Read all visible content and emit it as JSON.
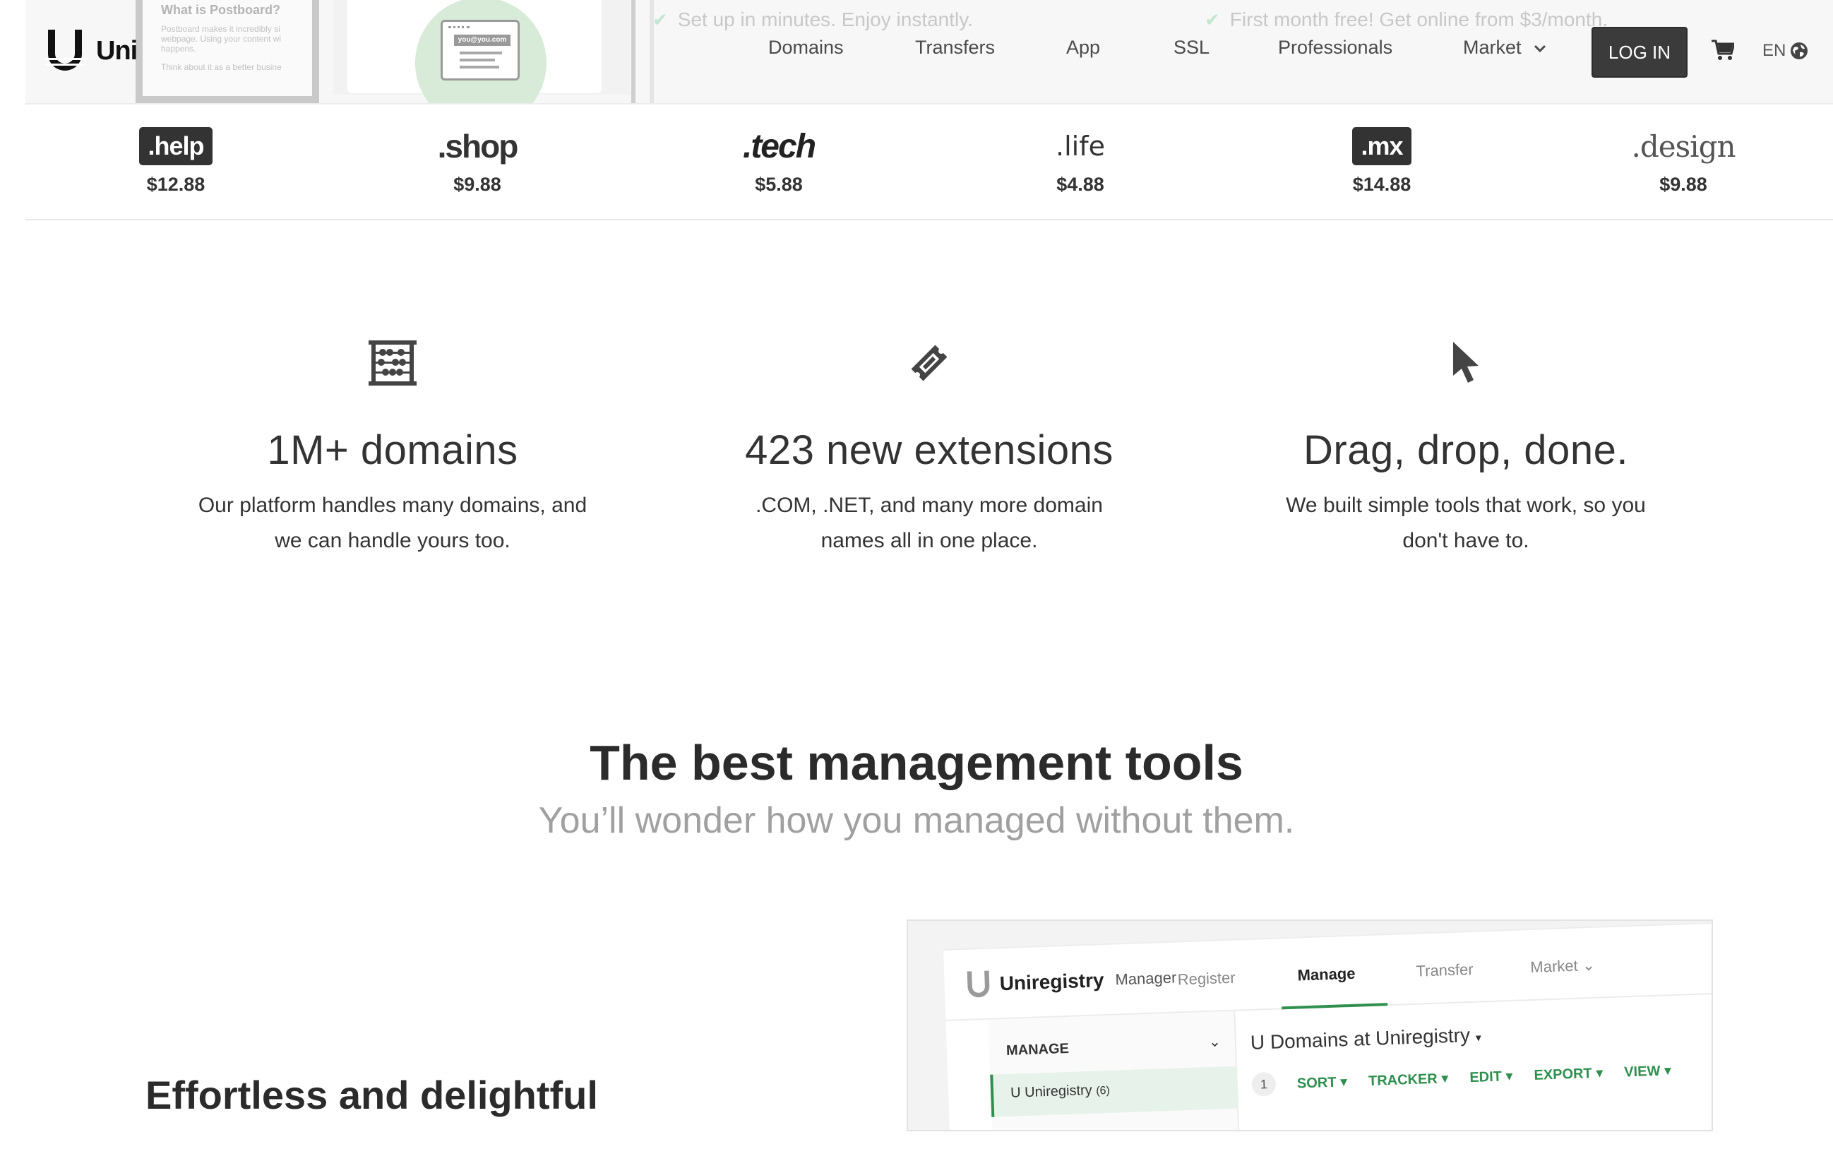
{
  "hero": {
    "phone_title": "What is Postboard?",
    "phone_lines": [
      "Postboard makes it incredibly si",
      "webpage. Using your content wi",
      "happens.",
      "Think about it as a better busine"
    ],
    "mock_email": "you@you.com",
    "perks": [
      "Set up in minutes. Enjoy instantly.",
      "First month free! Get online from $3/month."
    ]
  },
  "header": {
    "logo_text": "Uni",
    "nav": [
      "Domains",
      "Transfers",
      "App",
      "SSL",
      "Professionals",
      "Market"
    ],
    "market_chevron": "⌄",
    "login": "LOG IN",
    "language": "EN"
  },
  "extensions": [
    {
      "name": ".help",
      "price": "$12.88"
    },
    {
      "name": ".shop",
      "price": "$9.88"
    },
    {
      "name": ".tech",
      "price": "$5.88"
    },
    {
      "name": ".life",
      "price": "$4.88"
    },
    {
      "name": ".mx",
      "price": "$14.88"
    },
    {
      "name": ".design",
      "price": "$9.88"
    }
  ],
  "features": [
    {
      "icon": "abacus-icon",
      "title": "1M+ domains",
      "desc_line1": "Our platform handles many domains, and",
      "desc_line2": "we can handle yours too."
    },
    {
      "icon": "ticket-icon",
      "title": "423 new extensions",
      "desc_line1": ".COM, .NET, and many more domain",
      "desc_line2": "names all in one place."
    },
    {
      "icon": "cursor-icon",
      "title": "Drag, drop, done.",
      "desc_line1": "We built simple tools that work, so you",
      "desc_line2": "don't have to."
    }
  ],
  "management": {
    "title": "The best management tools",
    "subtitle": "You’ll wonder how you managed without them.",
    "section_heading": "Effortless and delightful"
  },
  "mockup": {
    "brand": "Uniregistry",
    "manager": "Manager",
    "tabs": [
      "Register",
      "Manage",
      "Transfer",
      "Market"
    ],
    "sidebar_head": "MANAGE",
    "sidebar_item": "Uniregistry",
    "sidebar_count": "(6)",
    "main_title": "Domains at Uniregistry",
    "count": "1",
    "tools": [
      "SORT",
      "TRACKER",
      "EDIT",
      "EXPORT",
      "VIEW"
    ]
  },
  "colors": {
    "accent_green": "#2f8f4e",
    "button_dark": "#3b3b3b",
    "text": "#333333"
  }
}
